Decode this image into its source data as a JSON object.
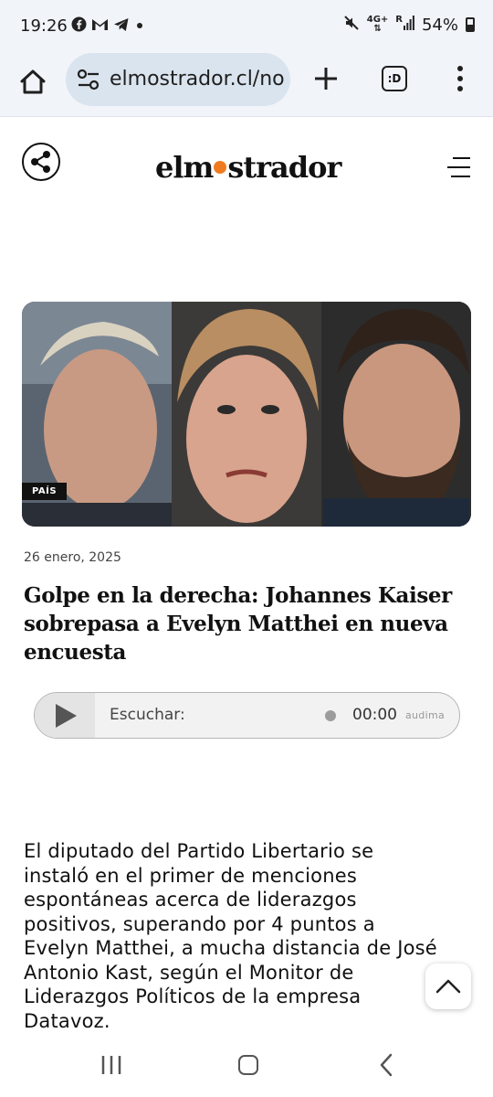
{
  "status_bar": {
    "time": "19:26",
    "app_icons": [
      "facebook-icon",
      "gmail-icon",
      "telegram-icon",
      "dot-icon"
    ],
    "network_label_top": "4G+",
    "network_label_bottom": "R",
    "battery_percent": "54%"
  },
  "browser": {
    "url": "elmostrador.cl/no",
    "tab_label": ":D"
  },
  "site": {
    "logo_before_dot": "elm",
    "logo_after_dot": "strador",
    "accent_color": "#ef7b21"
  },
  "article": {
    "category": "PAÍS",
    "date": "26 enero, 2025",
    "headline": "Golpe en la derecha: Johannes Kaiser sobrepasa a Evelyn Matthei en nueva encuesta",
    "body": "El diputado del Partido Libertario se instaló en el primer de menciones espontáneas acerca de liderazgos positivos, superando por 4 puntos a Evelyn Matthei, a mucha distancia de José Antonio Kast, según el Monitor de Liderazgos Políticos de la empresa Datavoz."
  },
  "audio_player": {
    "label": "Escuchar:",
    "time": "00:00",
    "brand": "audima"
  }
}
